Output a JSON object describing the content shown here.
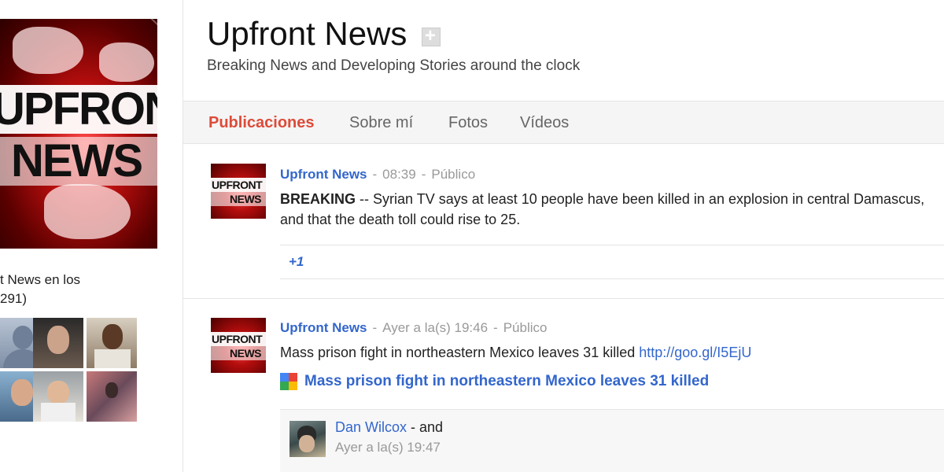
{
  "profile": {
    "logo_line1": "UPFRONT",
    "logo_line2": "NEWS",
    "name": "Upfront News",
    "tagline": "Breaking News and Developing Stories around the clock"
  },
  "circles": {
    "line1": "t News en los",
    "line2": "291)"
  },
  "tabs": [
    {
      "label": "Publicaciones",
      "active": true
    },
    {
      "label": "Sobre mí",
      "active": false
    },
    {
      "label": "Fotos",
      "active": false
    },
    {
      "label": "Vídeos",
      "active": false
    }
  ],
  "posts": [
    {
      "author": "Upfront News",
      "time": "08:39",
      "visibility": "Público",
      "lead": "BREAKING",
      "text": " -- Syrian TV says at least 10 people have been killed in an explosion in central Damascus, and that the death toll could rise to 25.",
      "plusone": "+1"
    },
    {
      "author": "Upfront News",
      "time": "Ayer a la(s) 19:46",
      "visibility": "Público",
      "text": "Mass prison fight in northeastern Mexico leaves 31 killed ",
      "link": "http://goo.gl/I5EjU",
      "shared_title": "Mass prison fight in northeastern Mexico leaves 31 killed",
      "comment": {
        "name": "Dan Wilcox",
        "rest": "  -  and",
        "time": "Ayer a la(s) 19:47"
      }
    }
  ],
  "colors": {
    "accent_red": "#dd4b39",
    "link_blue": "#3366cc"
  }
}
